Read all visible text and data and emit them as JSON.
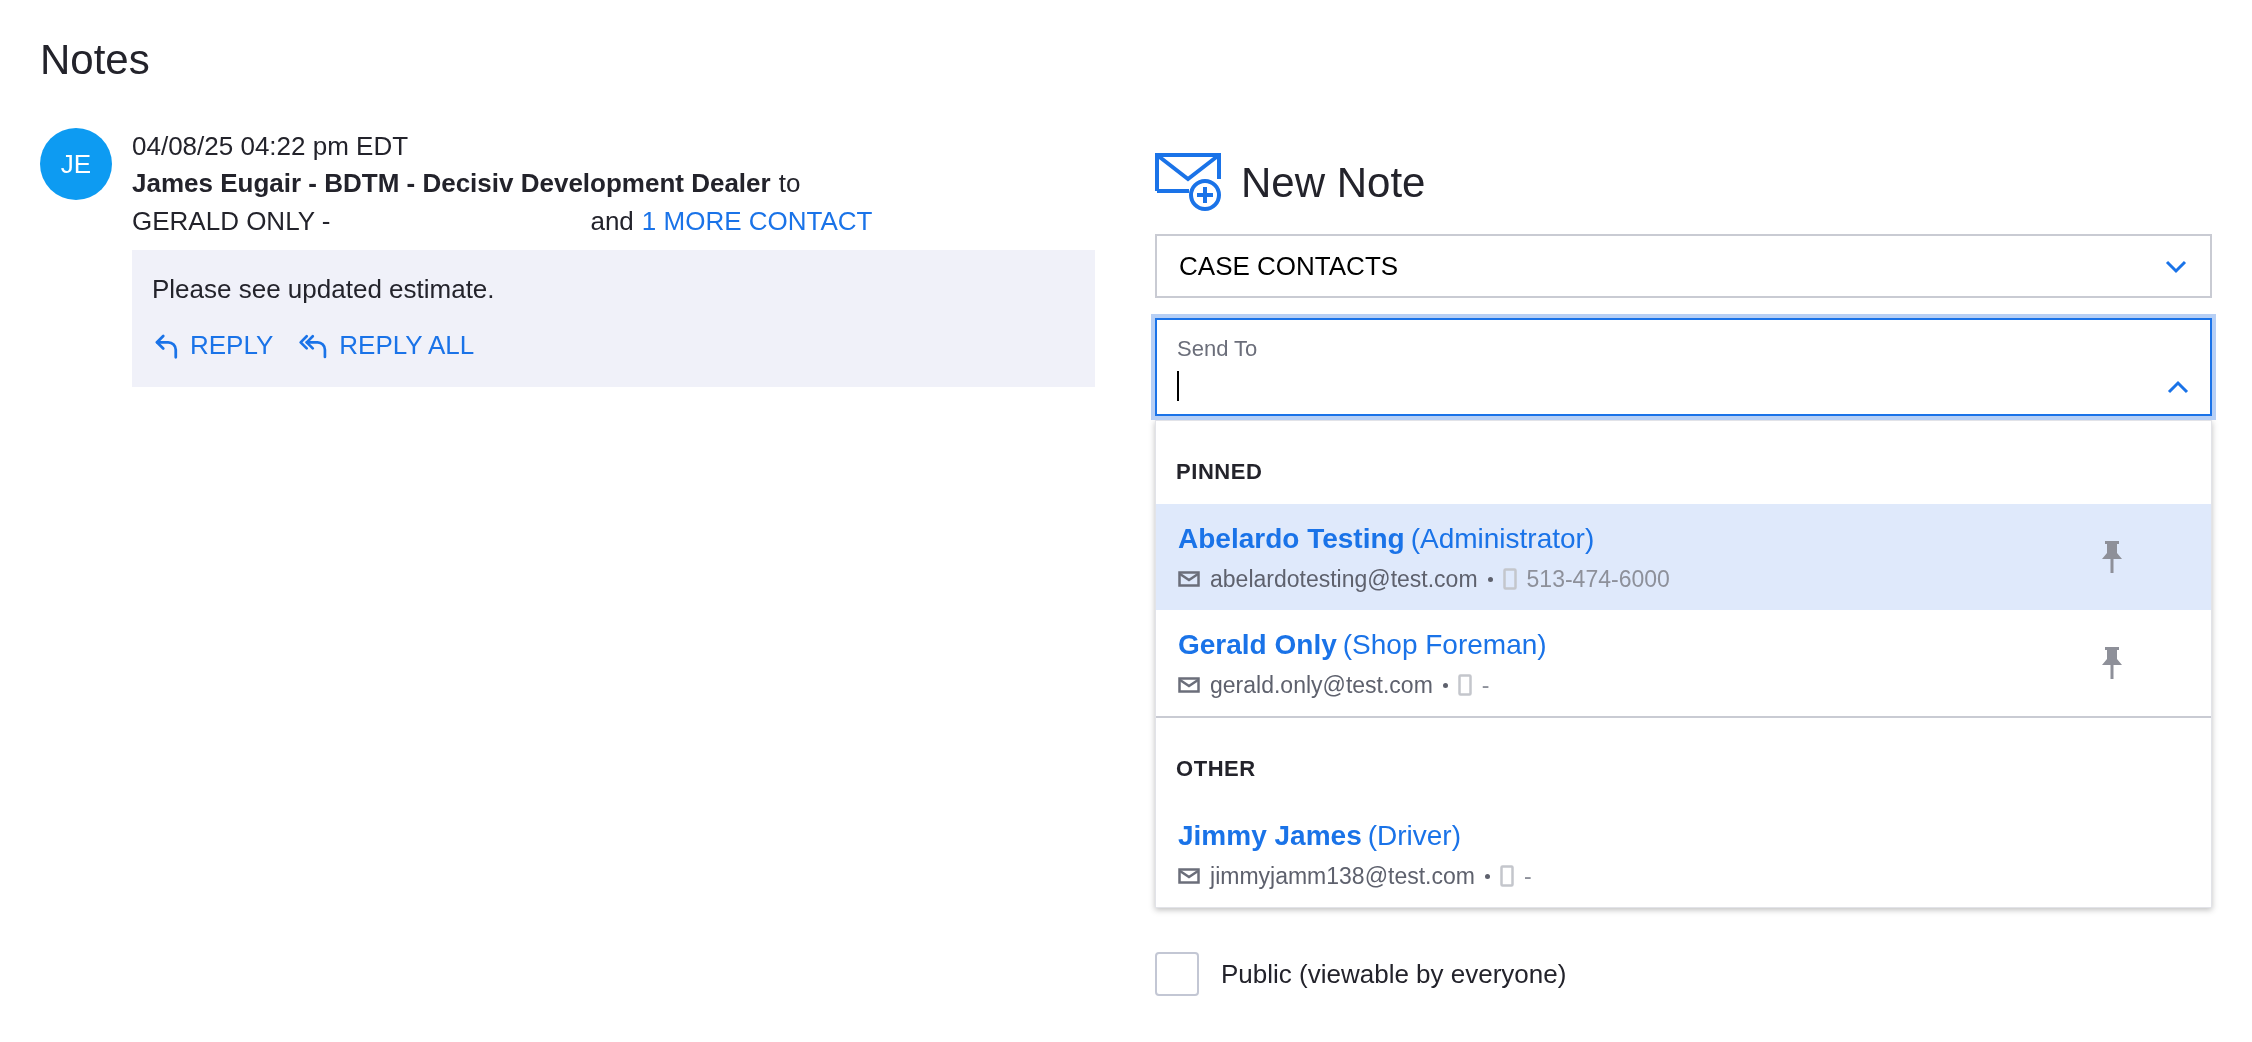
{
  "title": "Notes",
  "note": {
    "avatar": "JE",
    "timestamp": "04/08/25 04:22 pm EDT",
    "sender": "James Eugair - BDTM - Decisiv Development Dealer",
    "to_word": "to",
    "recipient": "GERALD ONLY -",
    "and_word": "and",
    "more_link": "1 MORE CONTACT",
    "body": "Please see updated estimate.",
    "actions": [
      {
        "kind": "reply",
        "label": "REPLY"
      },
      {
        "kind": "reply_all",
        "label": "REPLY ALL"
      }
    ]
  },
  "new_note": {
    "title": "New Note",
    "contact_select": {
      "value": "CASE CONTACTS"
    },
    "send_to": {
      "label": "Send To",
      "expanded": true
    },
    "groups": [
      {
        "heading": "PINNED",
        "contacts": [
          {
            "name": "Abelardo Testing",
            "role": "(Administrator)",
            "email": "abelardotesting@test.com",
            "phone": "513-474-6000",
            "pinned": true,
            "selected": true
          },
          {
            "name": "Gerald Only",
            "role": "(Shop Foreman)",
            "email": "gerald.only@test.com",
            "phone": "-",
            "pinned": true,
            "selected": false
          }
        ]
      },
      {
        "heading": "OTHER",
        "contacts": [
          {
            "name": "Jimmy James",
            "role": "(Driver)",
            "email": "jimmyjamm138@test.com",
            "phone": "-",
            "pinned": false,
            "selected": false
          }
        ]
      }
    ],
    "public": {
      "label": "Public (viewable by everyone)",
      "checked": false
    }
  }
}
